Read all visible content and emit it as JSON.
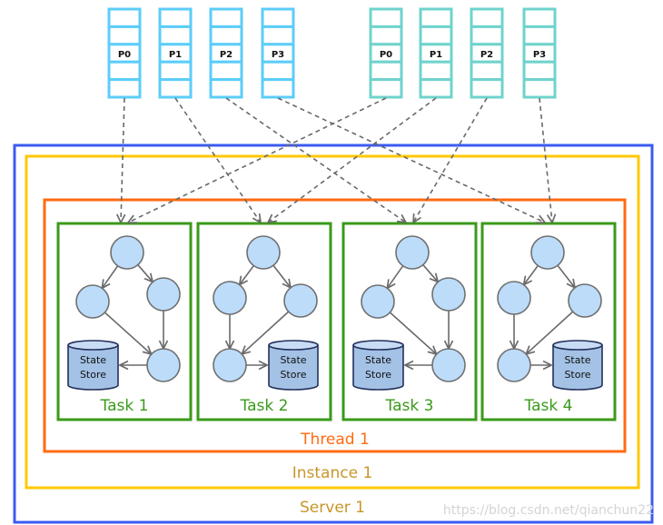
{
  "colors": {
    "server": "#3b5bf0",
    "instance": "#ffc800",
    "thread": "#ff6a10",
    "task": "#3a9a1a",
    "topic_a": "#5bcdf8",
    "topic_b": "#6fd3cc",
    "node_fill": "#bcdcfa",
    "store_fill": "#a4c2e6",
    "arrow": "#6a6a6a",
    "label_server": "#c8962a",
    "label_instance": "#c8962a",
    "label_thread": "#ff6a10",
    "label_task": "#3a9a1a"
  },
  "server": {
    "label": "Server 1"
  },
  "instance": {
    "label": "Instance 1"
  },
  "thread": {
    "label": "Thread 1"
  },
  "topics": [
    {
      "partitions": [
        "P0",
        "P1",
        "P2",
        "P3"
      ]
    },
    {
      "partitions": [
        "P0",
        "P1",
        "P2",
        "P3"
      ]
    }
  ],
  "tasks": [
    {
      "label": "Task 1",
      "store": "State Store",
      "store_side": "left"
    },
    {
      "label": "Task 2",
      "store": "State Store",
      "store_side": "right"
    },
    {
      "label": "Task 3",
      "store": "State Store",
      "store_side": "left"
    },
    {
      "label": "Task 4",
      "store": "State Store",
      "store_side": "right"
    }
  ],
  "assignments": [
    {
      "topic": 0,
      "partition": "P0",
      "task": "Task 1"
    },
    {
      "topic": 0,
      "partition": "P1",
      "task": "Task 2"
    },
    {
      "topic": 0,
      "partition": "P2",
      "task": "Task 3"
    },
    {
      "topic": 0,
      "partition": "P3",
      "task": "Task 4"
    },
    {
      "topic": 1,
      "partition": "P0",
      "task": "Task 1"
    },
    {
      "topic": 1,
      "partition": "P1",
      "task": "Task 2"
    },
    {
      "topic": 1,
      "partition": "P2",
      "task": "Task 3"
    },
    {
      "topic": 1,
      "partition": "P3",
      "task": "Task 4"
    }
  ],
  "watermark": "https://blog.csdn.net/qianchun22"
}
